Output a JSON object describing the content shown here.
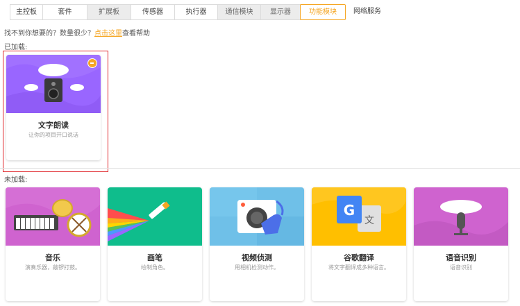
{
  "tabs": [
    {
      "label": "主控板",
      "style": "normal"
    },
    {
      "label": "套件",
      "style": "normal"
    },
    {
      "label": "扩展板",
      "style": "gray"
    },
    {
      "label": "传感器",
      "style": "normal"
    },
    {
      "label": "执行器",
      "style": "normal"
    },
    {
      "label": "通信模块",
      "style": "gray"
    },
    {
      "label": "显示器",
      "style": "gray"
    },
    {
      "label": "功能模块",
      "style": "active"
    },
    {
      "label": "网络服务",
      "style": "plain"
    }
  ],
  "hint": {
    "prefix": "找不到你想要的？数量很少？",
    "link": "点击这里",
    "suffix": "查看帮助"
  },
  "loaded_label": "已加载:",
  "unloaded_label": "未加载:",
  "loaded_cards": [
    {
      "title": "文字朗读",
      "desc": "让你的项目开口说话",
      "icon": "speaker-icon",
      "bg": "#9966ff"
    }
  ],
  "unloaded_cards": [
    {
      "title": "音乐",
      "desc": "演奏乐器，敲锣打鼓。",
      "icon": "music-icon",
      "bg": "#cf63cf"
    },
    {
      "title": "画笔",
      "desc": "绘制角色。",
      "icon": "pen-icon",
      "bg": "#0fbd8c"
    },
    {
      "title": "视频侦测",
      "desc": "用相机检测动作。",
      "icon": "video-sensing-icon",
      "bg": "#6fc0e8"
    },
    {
      "title": "谷歌翻译",
      "desc": "将文字翻译成多种语言。",
      "icon": "translate-icon",
      "bg": "#ffbf00"
    },
    {
      "title": "语音识别",
      "desc": "语音识别",
      "icon": "microphone-icon",
      "bg": "#cf63cf"
    }
  ],
  "colors": {
    "accent": "#f5a623",
    "highlight_border": "#e0262a"
  }
}
